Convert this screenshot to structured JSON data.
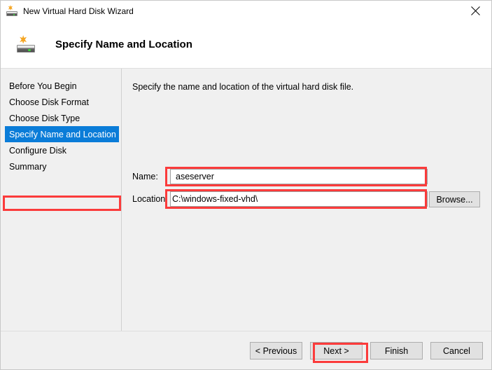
{
  "window": {
    "title": "New Virtual Hard Disk Wizard",
    "title_icon": "virtual-hard-disk-icon",
    "close_label": "✕"
  },
  "header": {
    "title": "Specify Name and Location",
    "icon": "virtual-hard-disk-icon"
  },
  "sidebar": {
    "items": [
      {
        "label": "Before You Begin",
        "selected": false
      },
      {
        "label": "Choose Disk Format",
        "selected": false
      },
      {
        "label": "Choose Disk Type",
        "selected": false
      },
      {
        "label": "Specify Name and Location",
        "selected": true
      },
      {
        "label": "Configure Disk",
        "selected": false
      },
      {
        "label": "Summary",
        "selected": false
      }
    ],
    "selected_index": 3
  },
  "main": {
    "intro_text": "Specify the name and location of the virtual hard disk file.",
    "fields": [
      {
        "label": "Name:",
        "value": "aseserver",
        "placeholder": ""
      },
      {
        "label": "Location:",
        "value": "C:\\windows-fixed-vhd\\",
        "placeholder": ""
      }
    ],
    "browse_label": "Browse..."
  },
  "footer": {
    "buttons": [
      {
        "label": "< Previous",
        "highlighted": false
      },
      {
        "label": "Next >",
        "highlighted": true
      },
      {
        "label": "Finish",
        "highlighted": false
      },
      {
        "label": "Cancel",
        "highlighted": false
      }
    ]
  },
  "annotations": {
    "color": "#fb3b3b",
    "targets": [
      "sidebar-item-specify-name-and-location",
      "name-field",
      "location-field",
      "next-button"
    ]
  },
  "colors": {
    "selection_blue": "#0a7cd8",
    "window_background": "#f0f0f0",
    "header_background": "#ffffff",
    "annotation_red": "#fb3b3b",
    "button_face": "#e1e1e1"
  }
}
